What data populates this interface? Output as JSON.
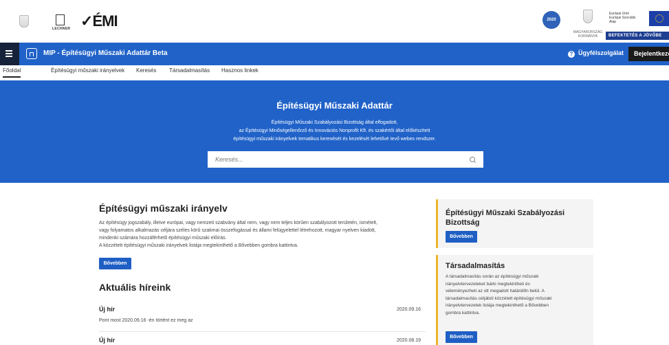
{
  "logos": {
    "lechner": "LECHNER",
    "emi": "ÉMI",
    "szechenyi": "2020",
    "gov": "MAGYARORSZÁG KORMÁNYA",
    "eu": [
      "Európai Unió",
      "Európai Szociális",
      "Alap"
    ],
    "eu_banner": "BEFEKTETÉS A JÖVŐBE"
  },
  "navbar": {
    "title": "MIP - Építésügyi Műszaki Adattár  Beta",
    "help": "Ügyfélszolgálat",
    "login": "Bejelentkezés"
  },
  "tabs": [
    "Főoldal",
    "Építésügyi műszaki irányelvek",
    "Keresés",
    "Társadalmasítás",
    "Hasznos linkek"
  ],
  "hero": {
    "title": "Építésügyi Műszaki Adattár",
    "desc": [
      "Építésügyi Műszaki Szabályozási Bizottság által elfogadott,",
      "az Építésügyi Minőségellenőrző és Innovációs Nonprofit Kft. és szakértői által előkészített",
      "építésügyi műszaki irányelvek tematikus keresését és kezelését lehetővé tevő webes rendszer."
    ],
    "search_placeholder": "Keresés..."
  },
  "main": {
    "title": "Építésügyi műszaki irányelv",
    "desc": [
      "Az építésügy jogszabály, illetve európai, vagy nemzeti szabvány által nem, vagy nem teljes körűen szabályozott területén, ismételt,",
      "vagy folyamatos alkalmazás céljára széles körű szakmai összefogással és állami felügyelettel létrehozott, magyar nyelven kiadott,",
      "mindenki számára hozzáférhető építésügyi műszaki előírás.",
      "A közzétett építésügyi műszaki irányelvek listája megtekinthető a Bővebben gombra kattintva."
    ],
    "more_button": "Bővebben"
  },
  "news": {
    "title": "Aktuális híreink",
    "items": [
      {
        "title": "Új hír",
        "date": "2020.09.16",
        "text": "Pont most 2020.09.16 -én történt ez meg az"
      },
      {
        "title": "Új hír",
        "date": "2020.08.19",
        "text": ""
      }
    ]
  },
  "side": [
    {
      "title_lines": [
        "Építésügyi Műszaki Szabályozási",
        "Bizottság"
      ],
      "button": "Bővebben"
    },
    {
      "title_lines": [
        "Társadalmasítás"
      ],
      "text": [
        "A társadalmasítás során az építésügyi műszaki",
        "irányelvtervezeteket bárki megtekintheti és",
        "véleményezheti az ott megadott határidőn belül. A",
        "társadalmasítás céljából közzétett építésügyi műszaki",
        "irányelvtervezetek listája megtekinthető a Bővebben",
        "gombra kattintva."
      ],
      "button": "Bővebben"
    }
  ]
}
